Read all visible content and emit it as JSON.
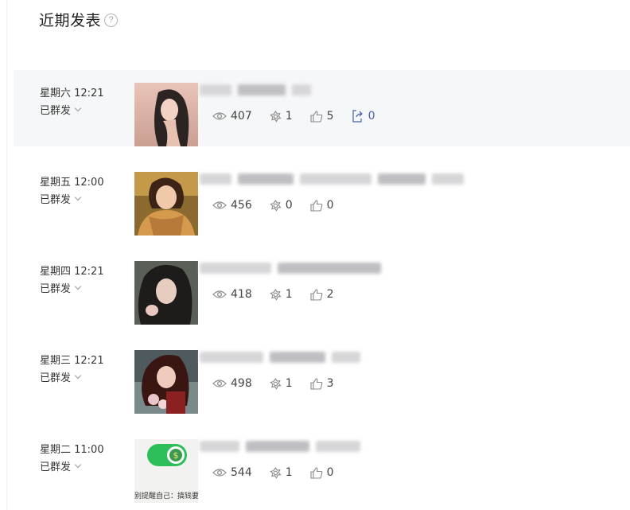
{
  "header": {
    "title": "近期发表",
    "help_glyph": "?"
  },
  "posts": [
    {
      "date": "星期六 12:21",
      "status": "已群发",
      "views": "407",
      "recommends": "1",
      "likes": "5",
      "shares": "0",
      "thumb": "woman-sunset"
    },
    {
      "date": "星期五 12:00",
      "status": "已群发",
      "views": "456",
      "recommends": "0",
      "likes": "0",
      "thumb": "woman-scarf"
    },
    {
      "date": "星期四 12:21",
      "status": "已群发",
      "views": "418",
      "recommends": "1",
      "likes": "2",
      "thumb": "woman-curly"
    },
    {
      "date": "星期三 12:21",
      "status": "已群发",
      "views": "498",
      "recommends": "1",
      "likes": "3",
      "thumb": "woman-flowers"
    },
    {
      "date": "星期二 11:00",
      "status": "已群发",
      "views": "544",
      "recommends": "1",
      "likes": "0",
      "thumb": "money-toggle",
      "thumb_caption": "别提醒自己：搞钱要"
    }
  ],
  "colors": {
    "share_accent": "#4a5fa8",
    "toggle_green": "#2fbf5a",
    "hover_row": "#f6f7f8"
  }
}
